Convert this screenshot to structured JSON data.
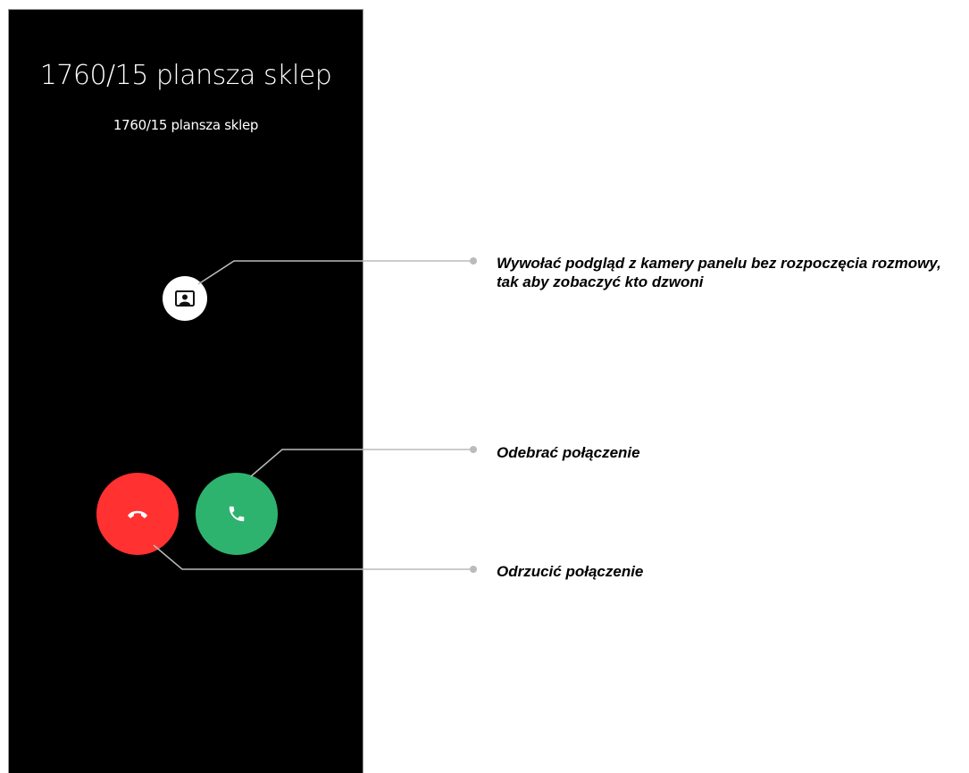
{
  "call_screen": {
    "title": "1760/15 plansza sklep",
    "subtitle": "1760/15 plansza sklep",
    "preview_icon": "camera-preview-icon",
    "reject_icon": "hang-up-icon",
    "answer_icon": "phone-icon"
  },
  "callouts": {
    "preview": "Wywołać podgląd z kamery panelu bez rozpoczęcia rozmowy, tak aby zobaczyć kto dzwoni",
    "answer": "Odebrać połączenie",
    "reject": "Odrzucić połączenie"
  },
  "colors": {
    "screen_background": "#000000",
    "reject": "#ff3131",
    "answer": "#2eb36f",
    "leader_line": "#bbbbbb"
  }
}
